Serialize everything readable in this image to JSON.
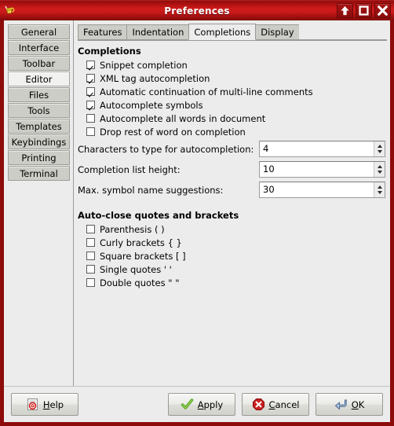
{
  "window": {
    "title": "Preferences",
    "app_icon": "geany-lamp-icon",
    "buttons": [
      {
        "name": "shade-button",
        "icon": "arrow-up-icon",
        "glyph": "⬆"
      },
      {
        "name": "maximize-button",
        "icon": "maximize-square-icon",
        "glyph": "□"
      },
      {
        "name": "close-button",
        "icon": "close-x-icon",
        "glyph": "✖"
      }
    ]
  },
  "sidebar": {
    "items": [
      {
        "label": "General",
        "selected": false
      },
      {
        "label": "Interface",
        "selected": false
      },
      {
        "label": "Toolbar",
        "selected": false
      },
      {
        "label": "Editor",
        "selected": true
      },
      {
        "label": "Files",
        "selected": false
      },
      {
        "label": "Tools",
        "selected": false
      },
      {
        "label": "Templates",
        "selected": false
      },
      {
        "label": "Keybindings",
        "selected": false
      },
      {
        "label": "Printing",
        "selected": false
      },
      {
        "label": "Terminal",
        "selected": false
      }
    ]
  },
  "tabs": [
    {
      "label": "Features",
      "active": false
    },
    {
      "label": "Indentation",
      "active": false
    },
    {
      "label": "Completions",
      "active": true
    },
    {
      "label": "Display",
      "active": false
    }
  ],
  "completions": {
    "heading": "Completions",
    "checkboxes": [
      {
        "label": "Snippet completion",
        "checked": true
      },
      {
        "label": "XML tag autocompletion",
        "checked": true
      },
      {
        "label": "Automatic continuation of multi-line comments",
        "checked": true
      },
      {
        "label": "Autocomplete symbols",
        "checked": true
      },
      {
        "label": "Autocomplete all words in document",
        "checked": false
      },
      {
        "label": "Drop rest of word on completion",
        "checked": false
      }
    ],
    "spinners": [
      {
        "label": "Characters to type for autocompletion:",
        "value": "4"
      },
      {
        "label": "Completion list height:",
        "value": "10"
      },
      {
        "label": "Max. symbol name suggestions:",
        "value": "30"
      }
    ]
  },
  "autoclose": {
    "heading": "Auto-close quotes and brackets",
    "checkboxes": [
      {
        "label": "Parenthesis ( )",
        "checked": false
      },
      {
        "label": "Curly brackets { }",
        "checked": false
      },
      {
        "label": "Square brackets [ ]",
        "checked": false
      },
      {
        "label": "Single quotes ' '",
        "checked": false
      },
      {
        "label": "Double quotes \" \"",
        "checked": false
      }
    ]
  },
  "actions": {
    "help": {
      "label": "Help",
      "mnemonic": "H",
      "icon": "help-document-icon"
    },
    "apply": {
      "label": "Apply",
      "mnemonic": "A",
      "icon": "green-check-icon"
    },
    "cancel": {
      "label": "Cancel",
      "mnemonic": "C",
      "icon": "red-octagon-x-icon"
    },
    "ok": {
      "label": "OK",
      "mnemonic": "O",
      "icon": "blue-enter-arrow-icon"
    }
  },
  "colors": {
    "titlebar_red": "#cb1a1a",
    "frame_red": "#8d0b0b",
    "panel_gray": "#ececec",
    "button_face": "#cdcdc7"
  }
}
